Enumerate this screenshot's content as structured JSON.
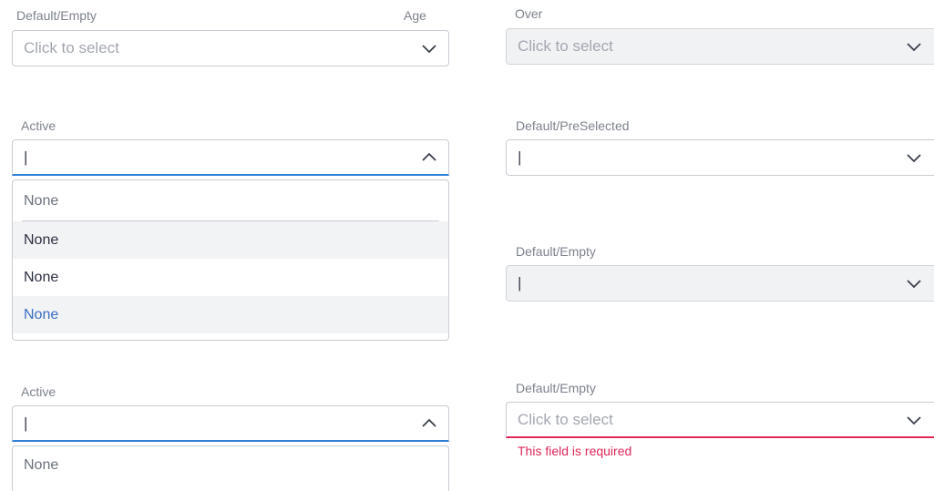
{
  "fields": {
    "age_select": {
      "label": "Default/Empty",
      "side_label": "Age",
      "placeholder": "Click to select"
    },
    "over_select": {
      "label": "Over",
      "placeholder": "Click to select"
    },
    "active_select_1": {
      "label": "Active",
      "value": "|",
      "options": [
        "None",
        "None",
        "None",
        "None"
      ]
    },
    "preselected_select": {
      "label": "Default/PreSelected",
      "value": "|"
    },
    "empty_select_2": {
      "label": "Default/Empty",
      "value": "|"
    },
    "active_select_2": {
      "label": "Active",
      "value": "|",
      "options": [
        "None"
      ]
    },
    "empty_select_error": {
      "label": "Default/Empty",
      "placeholder": "Click to select",
      "error": "This field is required"
    }
  },
  "colors": {
    "active_underline": "#2f80d8",
    "error": "#e02858",
    "selected_option": "#3a6fc4"
  }
}
